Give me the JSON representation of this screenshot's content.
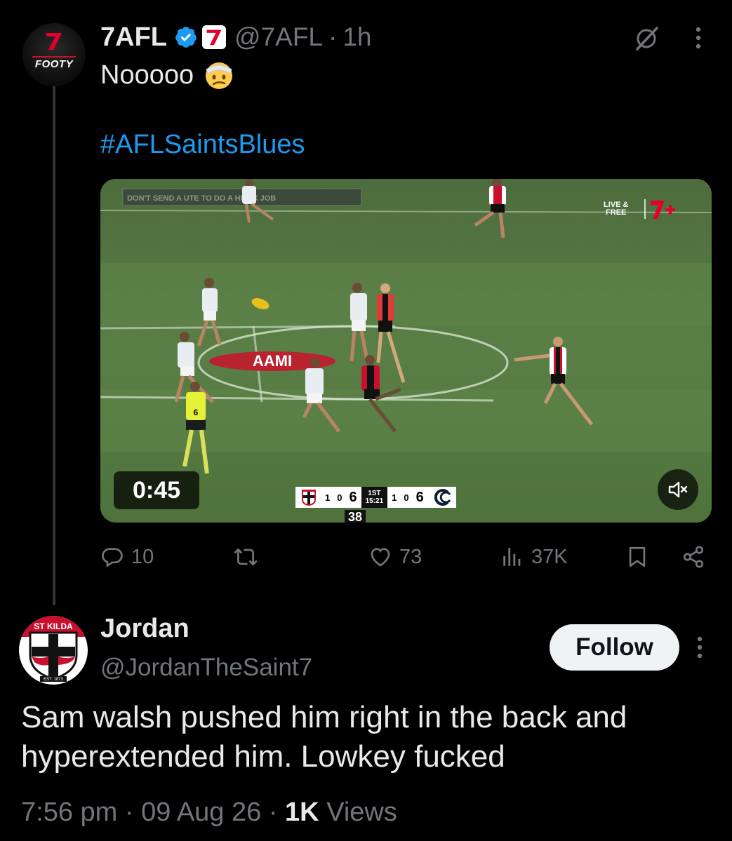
{
  "tweet": {
    "author_name": "7AFL",
    "handle": "@7AFL",
    "separator": "·",
    "time": "1h",
    "text": "Nooooo",
    "emoji": "face-with-head-bandage",
    "hashtag": "#AFLSaintsBlues",
    "avatar_label": "FOOTY",
    "video": {
      "duration": "0:45",
      "broadcaster_badge": "LIVE & FREE",
      "broadcaster_logo": "7+",
      "ground_signage": "AAMI",
      "boundary_sign": "DON'T SEND A UTE TO DO A HILUX JOB",
      "umpire_number": "6",
      "player_number": "38",
      "scorebug": {
        "home_team": "ST KILDA",
        "home_goals": "1",
        "home_behinds": "0",
        "home_total": "6",
        "quarter": "1ST",
        "clock": "15:21",
        "away_goals": "1",
        "away_behinds": "0",
        "away_total": "6"
      }
    },
    "stats": {
      "replies": "10",
      "likes": "73",
      "views": "37K"
    }
  },
  "reply": {
    "name": "Jordan",
    "handle": "@JordanTheSaint7",
    "avatar_label": "ST KILDA",
    "avatar_est": "EST. 1873",
    "follow_label": "Follow",
    "text": "Sam walsh pushed him right in the back and hyperextended him. Lowkey fucked",
    "time": "7:56 pm",
    "dot": "·",
    "date": "09 Aug 26",
    "views_count": "1K",
    "views_label": "Views"
  },
  "colors": {
    "background": "#000000",
    "text_primary": "#e7e9ea",
    "text_secondary": "#71767b",
    "link": "#1d9bf0",
    "verified": "#1d9bf0",
    "seven_red": "#e4002b"
  }
}
